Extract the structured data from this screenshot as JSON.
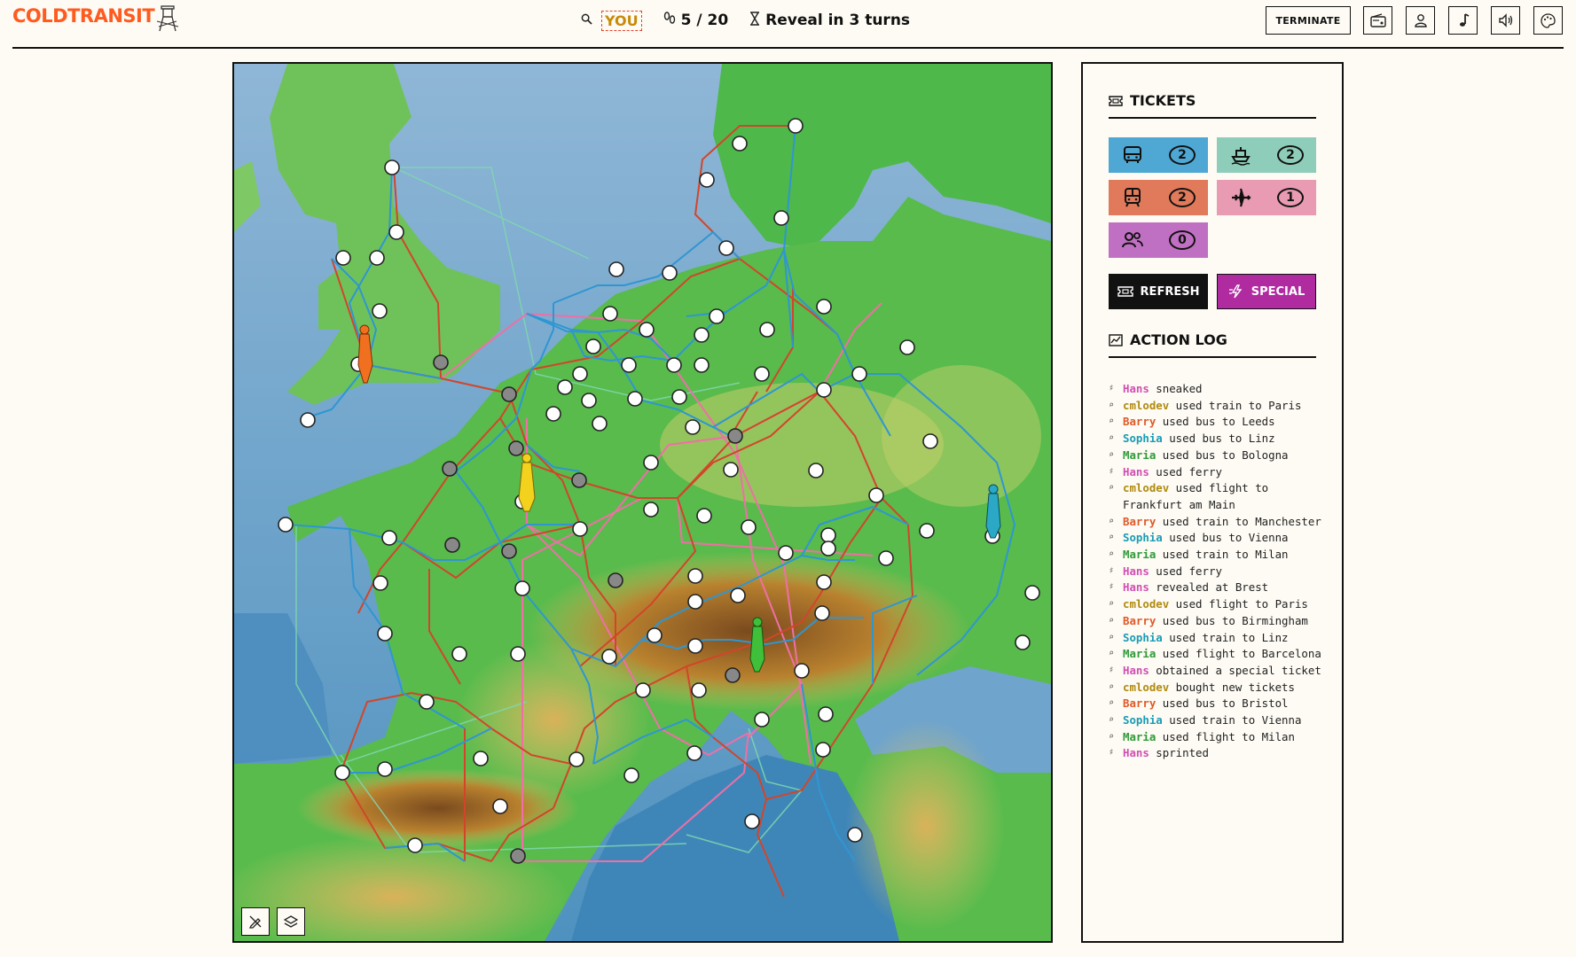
{
  "app": {
    "name": "COLDTRANSIT"
  },
  "header": {
    "player_label": "YOU",
    "turn_text": "5 / 20",
    "reveal_text": "Reveal in 3 turns",
    "terminate_label": "TERMINATE",
    "icons": [
      "search-icon",
      "footprints-icon",
      "hourglass-icon",
      "radio-icon",
      "user-icon",
      "music-icon",
      "volume-icon",
      "palette-icon"
    ]
  },
  "colors": {
    "logo": "#ff5a1f",
    "train": "#d2452b",
    "bus": "#2f96d2",
    "flight": "#e86aa0",
    "ferry": "#7fcfa8",
    "ticket_bus": "#4fa8d4",
    "ticket_ferry": "#8ecdb9",
    "ticket_train": "#e07a5a",
    "ticket_flight": "#e89bb3",
    "ticket_special": "#c070c2",
    "refresh_bg": "#111111",
    "special_bg": "#b02aa0"
  },
  "tickets": {
    "title": "TICKETS",
    "items": [
      {
        "type": "bus",
        "icon": "bus-icon",
        "count": "2"
      },
      {
        "type": "ferry",
        "icon": "ferry-icon",
        "count": "2"
      },
      {
        "type": "train",
        "icon": "train-icon",
        "count": "2"
      },
      {
        "type": "flight",
        "icon": "plane-icon",
        "count": "1"
      },
      {
        "type": "special",
        "icon": "group-icon",
        "count": "0"
      }
    ],
    "refresh_label": "REFRESH",
    "special_label": "SPECIAL"
  },
  "action_log": {
    "title": "ACTION LOG",
    "entries": [
      {
        "marker": "sprint",
        "name": "Hans",
        "color": "#d14fb3",
        "text": " sneaked"
      },
      {
        "marker": "search",
        "name": "cmlodev",
        "color": "#b08a10",
        "text": " used train to Paris"
      },
      {
        "marker": "search",
        "name": "Barry",
        "color": "#e05a2a",
        "text": " used bus to Leeds"
      },
      {
        "marker": "search",
        "name": "Sophia",
        "color": "#1a9bb5",
        "text": " used bus to Linz"
      },
      {
        "marker": "search",
        "name": "Maria",
        "color": "#2f9a3a",
        "text": " used bus to Bologna"
      },
      {
        "marker": "sprint",
        "name": "Hans",
        "color": "#d14fb3",
        "text": " used ferry"
      },
      {
        "marker": "search",
        "name": "cmlodev",
        "color": "#b08a10",
        "text": " used flight to Frankfurt am Main"
      },
      {
        "marker": "search",
        "name": "Barry",
        "color": "#e05a2a",
        "text": " used train to Manchester"
      },
      {
        "marker": "search",
        "name": "Sophia",
        "color": "#1a9bb5",
        "text": " used bus to Vienna"
      },
      {
        "marker": "search",
        "name": "Maria",
        "color": "#2f9a3a",
        "text": " used train to Milan"
      },
      {
        "marker": "sprint",
        "name": "Hans",
        "color": "#d14fb3",
        "text": " used ferry"
      },
      {
        "marker": "sprint",
        "name": "Hans",
        "color": "#d14fb3",
        "text": " revealed at Brest"
      },
      {
        "marker": "search",
        "name": "cmlodev",
        "color": "#b08a10",
        "text": " used flight to Paris"
      },
      {
        "marker": "search",
        "name": "Barry",
        "color": "#e05a2a",
        "text": " used bus to Birmingham"
      },
      {
        "marker": "search",
        "name": "Sophia",
        "color": "#1a9bb5",
        "text": " used train to Linz"
      },
      {
        "marker": "search",
        "name": "Maria",
        "color": "#2f9a3a",
        "text": " used flight to Barcelona"
      },
      {
        "marker": "sprint",
        "name": "Hans",
        "color": "#d14fb3",
        "text": " obtained a special ticket"
      },
      {
        "marker": "search",
        "name": "cmlodev",
        "color": "#b08a10",
        "text": " bought new tickets"
      },
      {
        "marker": "search",
        "name": "Barry",
        "color": "#e05a2a",
        "text": " used bus to Bristol"
      },
      {
        "marker": "search",
        "name": "Sophia",
        "color": "#1a9bb5",
        "text": " used train to Vienna"
      },
      {
        "marker": "search",
        "name": "Maria",
        "color": "#2f9a3a",
        "text": " used flight to Milan"
      },
      {
        "marker": "sprint",
        "name": "Hans",
        "color": "#d14fb3",
        "text": " sprinted"
      }
    ]
  },
  "map_tools": [
    {
      "name": "draw-tool-button",
      "icon": "pen-slash-icon"
    },
    {
      "name": "layers-button",
      "icon": "layers-icon"
    }
  ]
}
